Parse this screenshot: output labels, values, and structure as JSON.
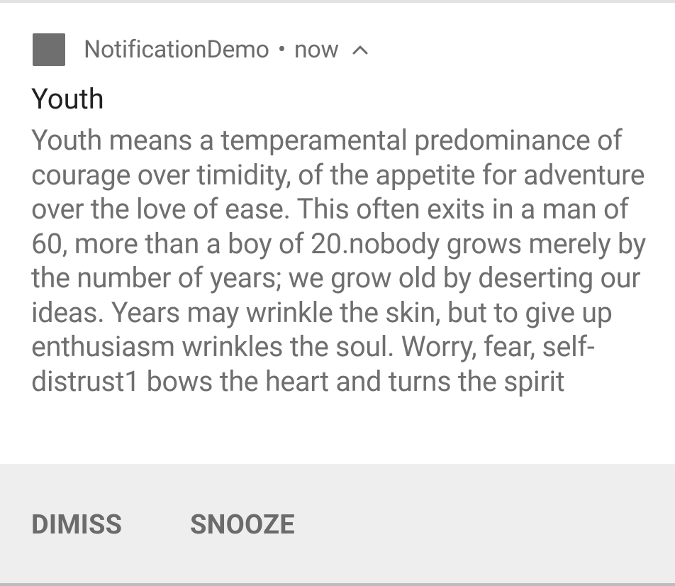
{
  "notification": {
    "app_name": "NotificationDemo",
    "separator": "•",
    "time": "now",
    "icon": "expand-chevron-up-icon",
    "title": "Youth",
    "body": "Youth means a temperamental predominance of courage over timidity, of the appetite for adventure over the love of ease. This often exits in a man of 60, more than a boy of 20.nobody grows merely by the number of years; we grow old by deserting our ideas. Years may wrinkle the skin, but to give up enthusiasm wrinkles the soul. Worry, fear, self-distrust1 bows the heart and turns the spirit"
  },
  "actions": {
    "dismiss_label": "DIMISS",
    "snooze_label": "SNOOZE"
  },
  "colors": {
    "app_icon": "#6f6f6f",
    "title": "#212121",
    "body": "#6f6f6f",
    "action_bar": "#eeeeee",
    "action_text": "#6b6b6b"
  }
}
